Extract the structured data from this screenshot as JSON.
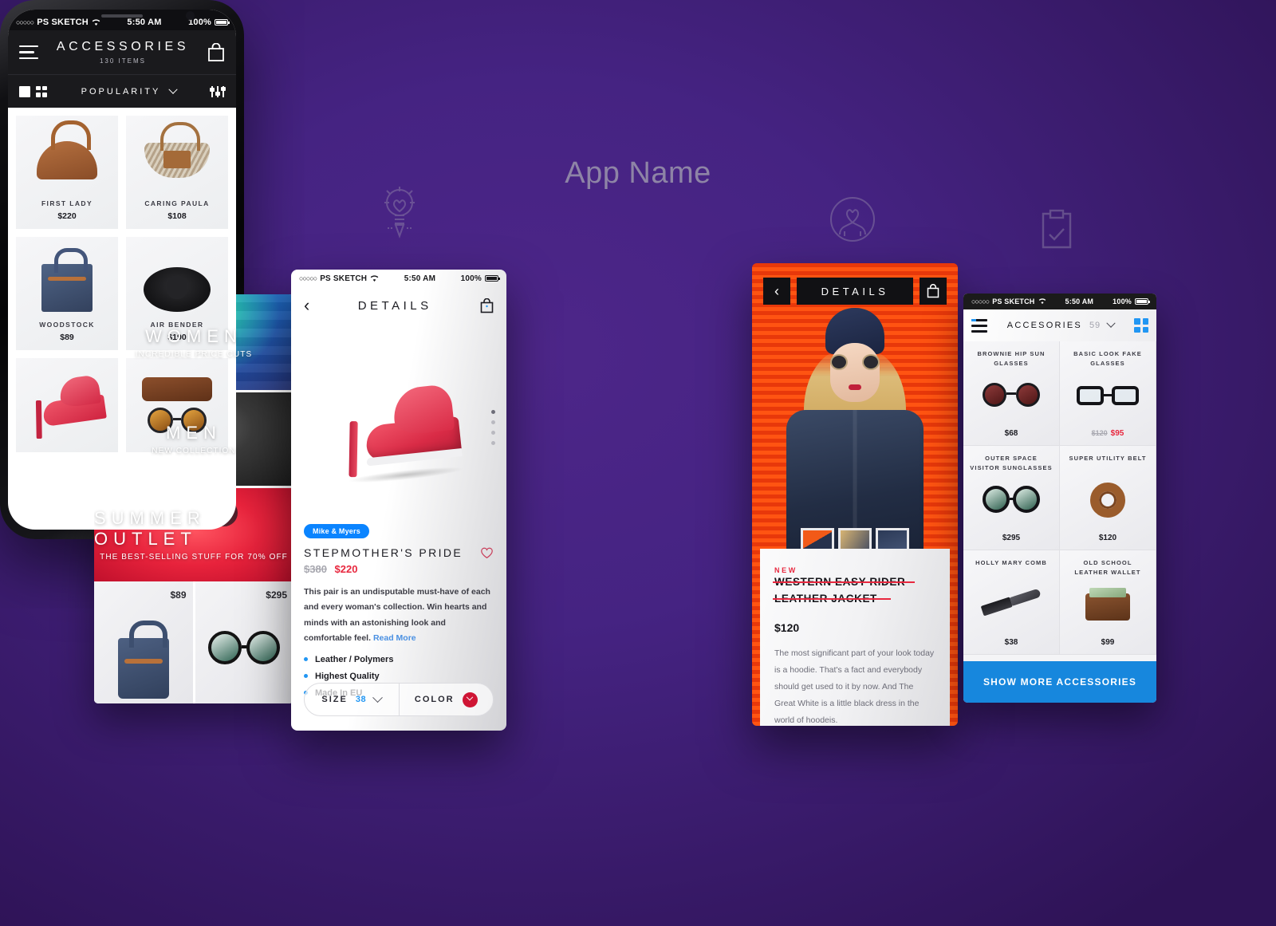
{
  "hero": {
    "app_name": "App Name",
    "background_color": "#452382",
    "decor_icons": [
      {
        "name": "waveform-icon"
      },
      {
        "name": "lightbulb-pencil-icon"
      },
      {
        "name": "user-circle-icon"
      },
      {
        "name": "clipboard-check-icon"
      }
    ]
  },
  "status_bar": {
    "carrier": "PS SKETCH",
    "dots": "○○○○○",
    "time": "5:50 AM",
    "battery": "100%"
  },
  "categories_screen": {
    "tiles": [
      {
        "title": "WOMEN",
        "subtitle": "INCREDIBLE PRICE CUTS"
      },
      {
        "title": "MEN",
        "subtitle": "NEW COLLECTION"
      },
      {
        "title": "SUMMER OUTLET",
        "subtitle": "THE BEST-SELLING STUFF FOR 70% OFF"
      }
    ],
    "products": [
      {
        "name": "denim-tote-bag",
        "price": "$89"
      },
      {
        "name": "round-sunglasses",
        "price": "$295"
      }
    ]
  },
  "details_screen": {
    "nav": {
      "back": "‹",
      "title": "DETAILS",
      "bag_icon": "shopping-bag-icon"
    },
    "brand": "Mike & Myers",
    "product_name": "STEPMOTHER'S PRIDE",
    "price_old": "$380",
    "price_new": "$220",
    "description": "This pair is an undisputable must-have of each and every woman's collection. Win hearts and minds with an astonishing look and comfortable feel.",
    "read_more": "Read More",
    "features": [
      "Leather / Polymers",
      "Highest Quality",
      "Made In EU"
    ],
    "size_label": "SIZE",
    "size_value": "38",
    "color_label": "COLOR",
    "color_value": "#cf1534"
  },
  "center_phone": {
    "header": {
      "menu_icon": "hamburger-icon",
      "title": "ACCESSORIES",
      "count": "130 ITEMS",
      "bag_icon": "shopping-bag-icon"
    },
    "toolbar": {
      "view_single": "single-column-view-icon",
      "view_grid": "grid-view-icon",
      "sort_label": "POPULARITY",
      "filter_icon": "filter-sliders-icon"
    },
    "products": [
      {
        "name": "FIRST LADY",
        "price": "$220",
        "art": "art-satchel"
      },
      {
        "name": "CARING PAULA",
        "price": "$108",
        "art": "art-basket"
      },
      {
        "name": "WOODSTOCK",
        "price": "$89",
        "art": "art-tote"
      },
      {
        "name": "AIR BENDER",
        "price": "$190",
        "art": "art-hat"
      }
    ]
  },
  "jacket_screen": {
    "nav": {
      "back": "‹",
      "title": "DETAILS",
      "bag_icon": "shopping-bag-icon"
    },
    "badge": "NEW",
    "name_line1": "WESTERN EASY RIDER",
    "name_line2": "LEATHER JACKET",
    "price": "$120",
    "description": "The most significant part of your look today is a hoodie. That's a fact and everybody should get used to it by now. And The Great White is a little black dress in the world of hoodeis.",
    "thumbnails": [
      "thumb-model-full",
      "thumb-jacket-detail",
      "thumb-jacket-pocket"
    ]
  },
  "accessories_screen": {
    "bar": {
      "list_icon": "list-view-icon",
      "title": "ACCESORIES",
      "count": "59",
      "grid_icon": "grid-view-icon"
    },
    "items": [
      {
        "name": "BROWNIE HIP SUN GLASSES",
        "price": "$68",
        "art": "a-brownie"
      },
      {
        "name": "BASIC LOOK FAKE GLASSES",
        "price_old": "$120",
        "price_new": "$95",
        "art": "a-basic"
      },
      {
        "name": "OUTER SPACE VISITOR SUNGLASSES",
        "price": "$295",
        "art": "a-outer"
      },
      {
        "name": "SUPER UTILITY BELT",
        "price": "$120",
        "art": "a-belt"
      },
      {
        "name": "HOLLY MARY COMB",
        "price": "$38",
        "art": "a-comb"
      },
      {
        "name": "OLD SCHOOL LEATHER WALLET",
        "price": "$99",
        "art": "a-wallet"
      }
    ],
    "cta": "SHOW MORE ACCESSORIES"
  }
}
